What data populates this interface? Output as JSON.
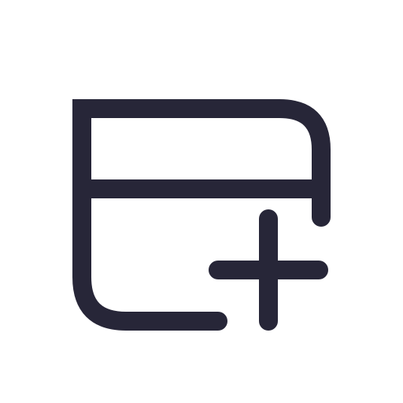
{
  "icon": {
    "name": "add-card-icon",
    "stroke_color": "#272638",
    "background_color": "#ffffff"
  }
}
